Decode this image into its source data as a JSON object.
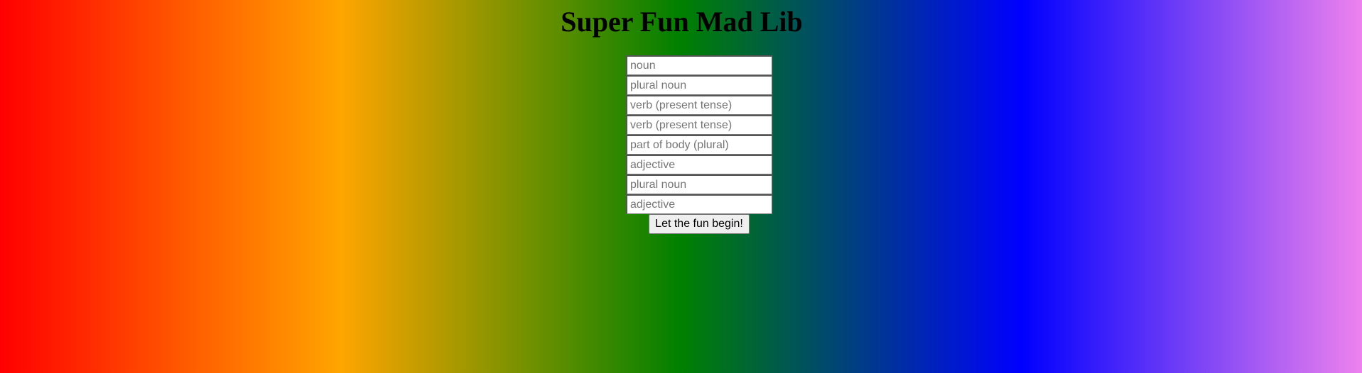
{
  "page": {
    "title": "Super Fun Mad Lib"
  },
  "form": {
    "fields": [
      {
        "placeholder": "noun",
        "value": ""
      },
      {
        "placeholder": "plural noun",
        "value": ""
      },
      {
        "placeholder": "verb (present tense)",
        "value": ""
      },
      {
        "placeholder": "verb (present tense)",
        "value": ""
      },
      {
        "placeholder": "part of body (plural)",
        "value": ""
      },
      {
        "placeholder": "adjective",
        "value": ""
      },
      {
        "placeholder": "plural noun",
        "value": ""
      },
      {
        "placeholder": "adjective",
        "value": ""
      }
    ],
    "submit_label": "Let the fun begin!"
  },
  "colors": {
    "gradient": [
      "#ff0000",
      "#ffa500",
      "#008000",
      "#0000ff",
      "#ee82ee"
    ]
  }
}
